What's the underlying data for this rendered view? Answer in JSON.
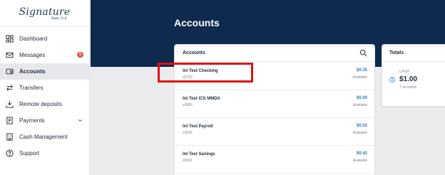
{
  "brand": {
    "logo_main": "Signature",
    "logo_sub": "Bank, N.A."
  },
  "sidebar": {
    "items": [
      {
        "label": "Dashboard",
        "icon": "dashboard-icon"
      },
      {
        "label": "Messages",
        "icon": "mail-icon",
        "badge": "5"
      },
      {
        "label": "Accounts",
        "icon": "wallet-icon",
        "active": true
      },
      {
        "label": "Transfers",
        "icon": "transfer-icon"
      },
      {
        "label": "Remote deposits",
        "icon": "deposit-icon"
      },
      {
        "label": "Payments",
        "icon": "payments-icon"
      },
      {
        "label": "Cash Management",
        "icon": "building-icon"
      },
      {
        "label": "Support",
        "icon": "help-icon"
      }
    ]
  },
  "header": {
    "title": "Accounts"
  },
  "accounts_card": {
    "title": "Accounts",
    "rows": [
      {
        "name": "Int Test Checking",
        "number": "x0750",
        "balance": "$0.35",
        "status": "Available"
      },
      {
        "name": "Int Test ICS MMDA",
        "number": "x0990",
        "balance": "$0.00",
        "status": "Available"
      },
      {
        "name": "Int Test Payroll",
        "number": "x3556",
        "balance": "$0.03",
        "status": "Available"
      },
      {
        "name": "Int Test Savings",
        "number": "x0592",
        "balance": "$0.42",
        "status": "Available"
      }
    ]
  },
  "totals_card": {
    "title": "Totals",
    "cash_label": "CASH",
    "cash_amount": "$1.00",
    "accounts_count": "7 accounts"
  },
  "colors": {
    "header_bg": "#0e2a4f",
    "link_blue": "#2a7ab8",
    "highlight": "#e01010",
    "badge": "#e2533d"
  }
}
